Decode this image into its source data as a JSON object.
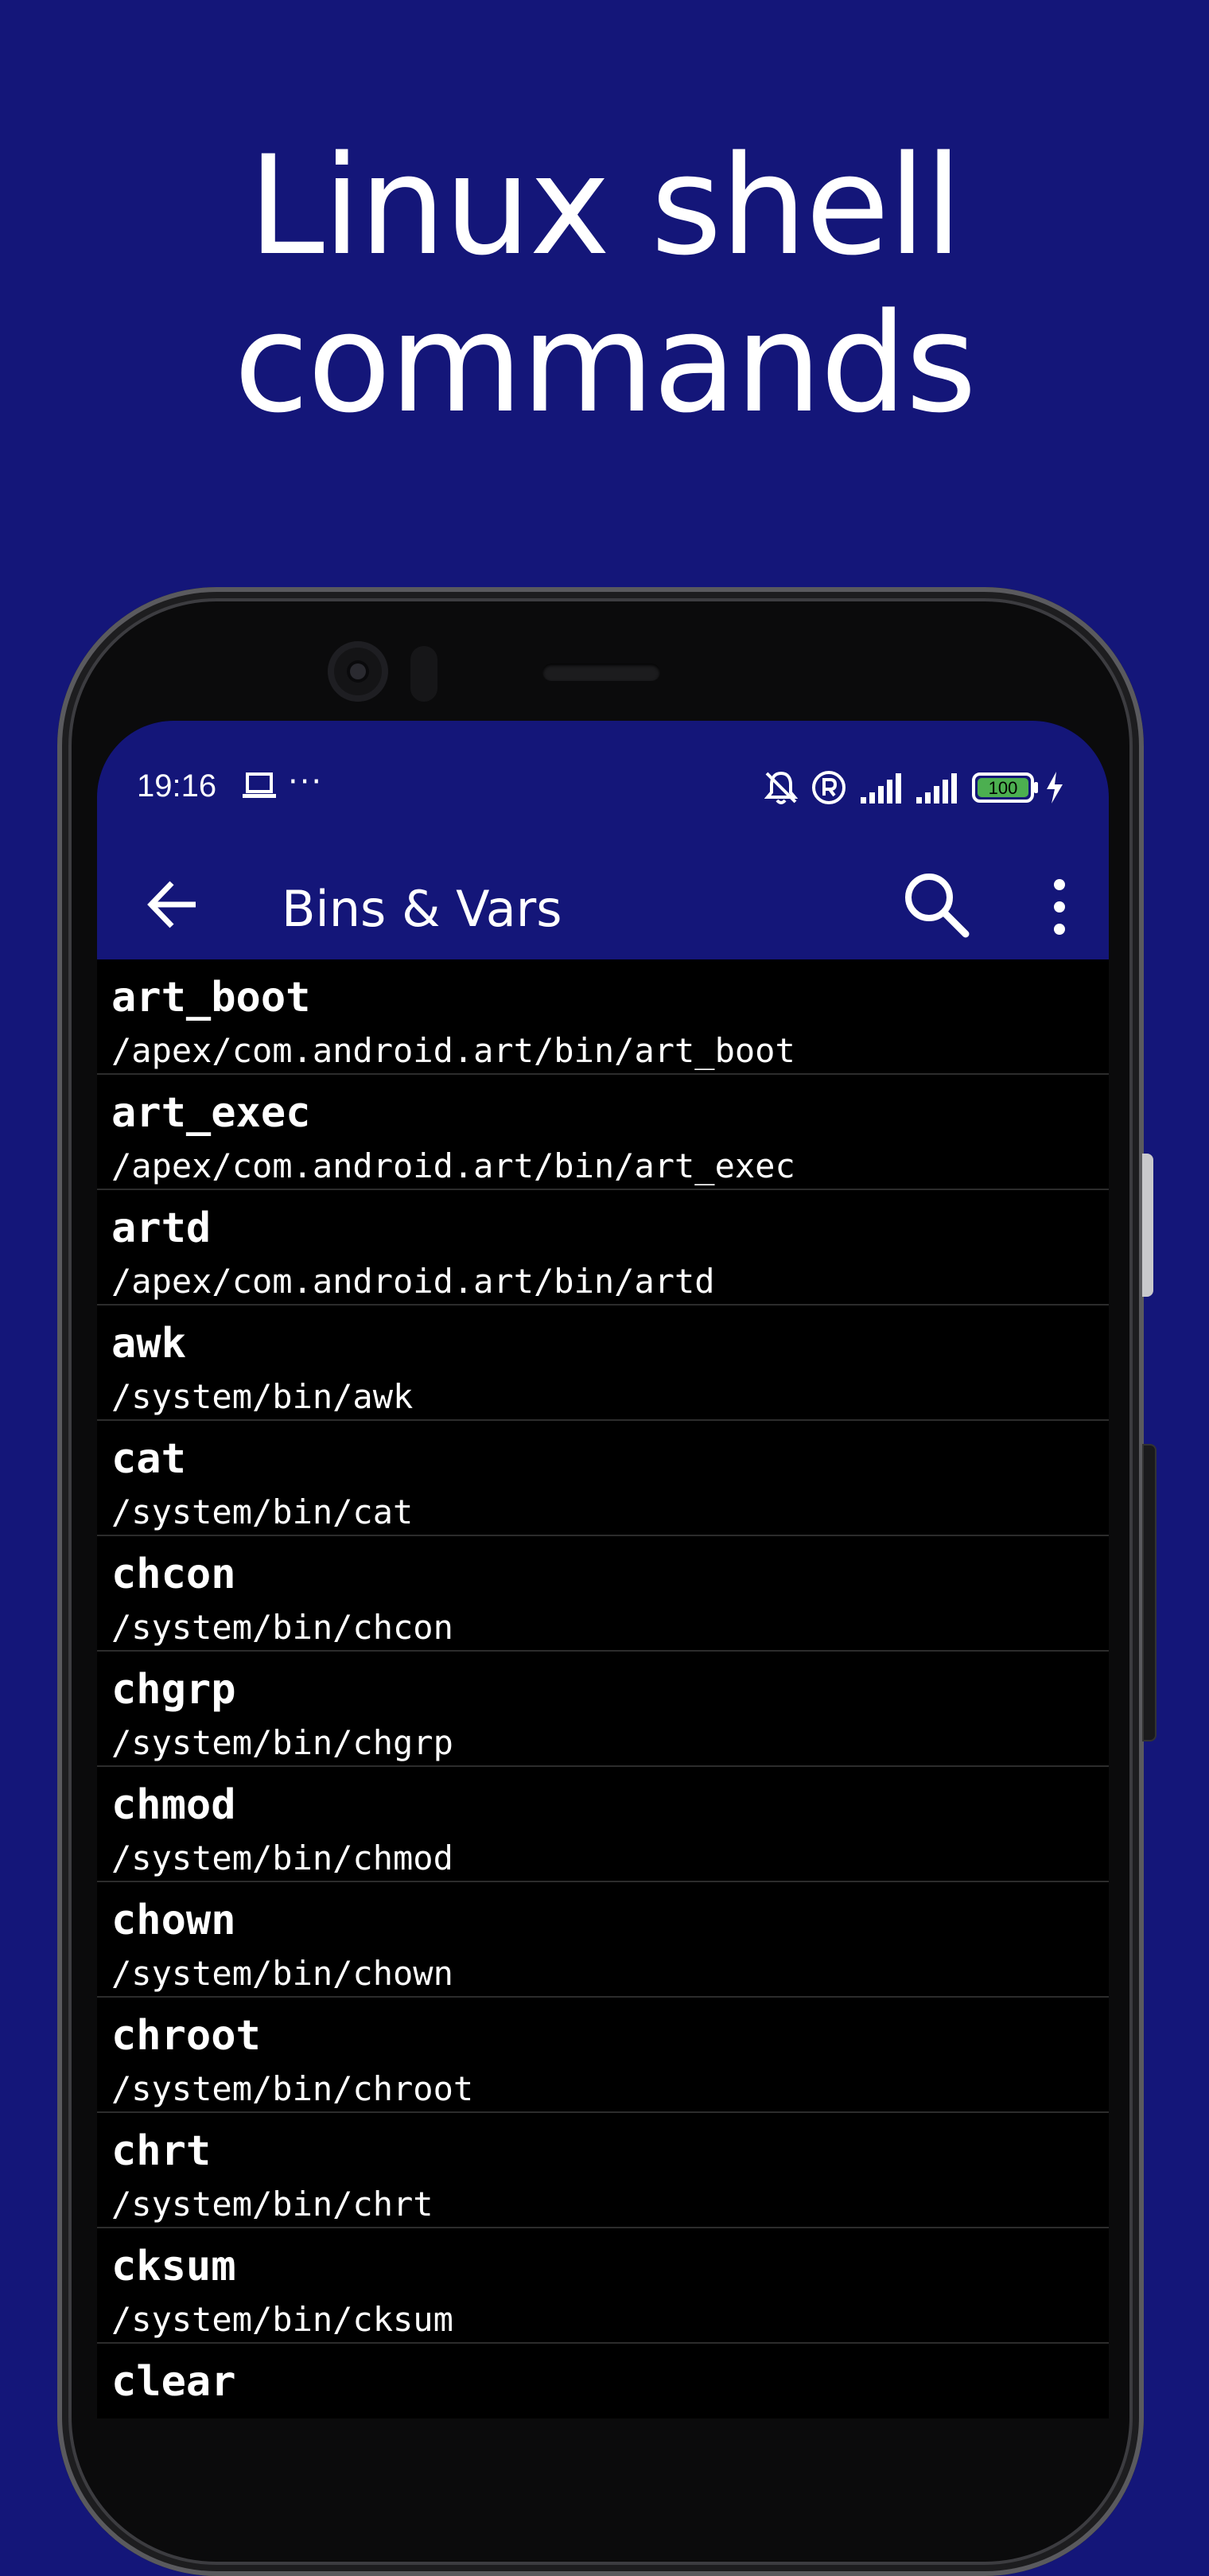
{
  "promo": {
    "line1": "Linux shell",
    "line2": "commands"
  },
  "colors": {
    "background": "#141679",
    "appbar": "#141679",
    "list_background": "#000000",
    "battery_fill": "#4caf50"
  },
  "status_bar": {
    "time": "19:16",
    "more_indicator": "···",
    "battery": "100",
    "icons": [
      "laptop-icon",
      "bell-off-icon",
      "registered-icon",
      "signal-icon",
      "signal-icon",
      "battery-icon",
      "charging-icon"
    ]
  },
  "app_bar": {
    "title": "Bins & Vars",
    "icons": [
      "back-arrow-icon",
      "search-icon",
      "more-vert-icon"
    ]
  },
  "items": [
    {
      "name": "art_boot",
      "path": "/apex/com.android.art/bin/art_boot"
    },
    {
      "name": "art_exec",
      "path": "/apex/com.android.art/bin/art_exec"
    },
    {
      "name": "artd",
      "path": "/apex/com.android.art/bin/artd"
    },
    {
      "name": "awk",
      "path": "/system/bin/awk"
    },
    {
      "name": "cat",
      "path": "/system/bin/cat"
    },
    {
      "name": "chcon",
      "path": "/system/bin/chcon"
    },
    {
      "name": "chgrp",
      "path": "/system/bin/chgrp"
    },
    {
      "name": "chmod",
      "path": "/system/bin/chmod"
    },
    {
      "name": "chown",
      "path": "/system/bin/chown"
    },
    {
      "name": "chroot",
      "path": "/system/bin/chroot"
    },
    {
      "name": "chrt",
      "path": "/system/bin/chrt"
    },
    {
      "name": "cksum",
      "path": "/system/bin/cksum"
    },
    {
      "name": "clear",
      "path": ""
    }
  ]
}
